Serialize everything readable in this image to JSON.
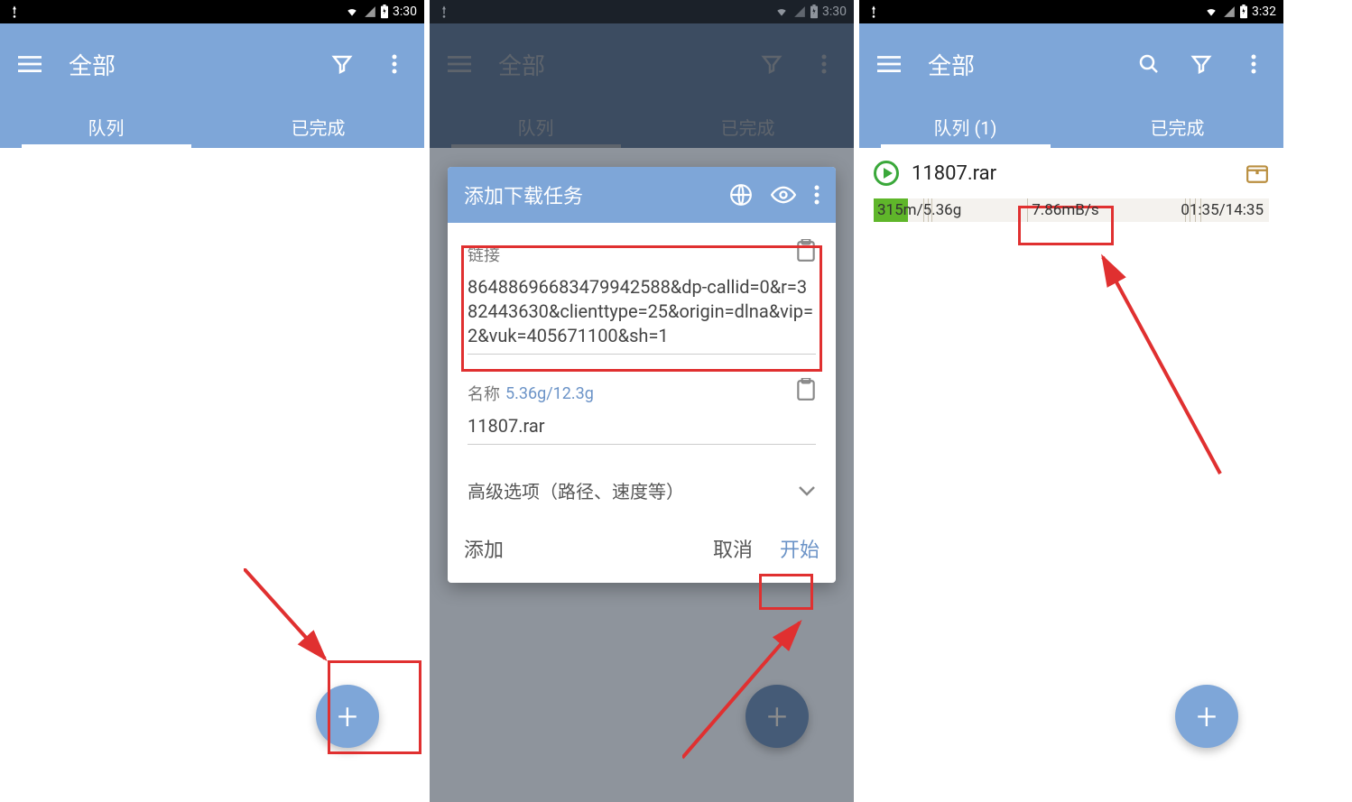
{
  "screen1": {
    "status_time": "3:30",
    "title": "全部",
    "tab_queue": "队列",
    "tab_done": "已完成"
  },
  "screen2": {
    "status_time": "3:30",
    "title": "全部",
    "tab_queue": "队列",
    "tab_done": "已完成",
    "dialog": {
      "title": "添加下载任务",
      "link_label": "链接",
      "link_value": "86488696683479942588&dp-callid=0&r=382443630&clienttype=25&origin=dlna&vip=2&vuk=405671100&sh=1",
      "name_label": "名称",
      "name_size": "5.36g/12.3g",
      "name_value": "11807.rar",
      "advanced": "高级选项（路径、速度等）",
      "action_add": "添加",
      "action_cancel": "取消",
      "action_start": "开始"
    }
  },
  "screen3": {
    "status_time": "3:32",
    "title": "全部",
    "tab_queue": "队列 (1)",
    "tab_done": "已完成",
    "download": {
      "filename": "11807.rar",
      "progress": "315m/5.36g",
      "speed": "7.86mB/s",
      "eta": "01:35/14:35"
    }
  },
  "fab_plus": "+"
}
